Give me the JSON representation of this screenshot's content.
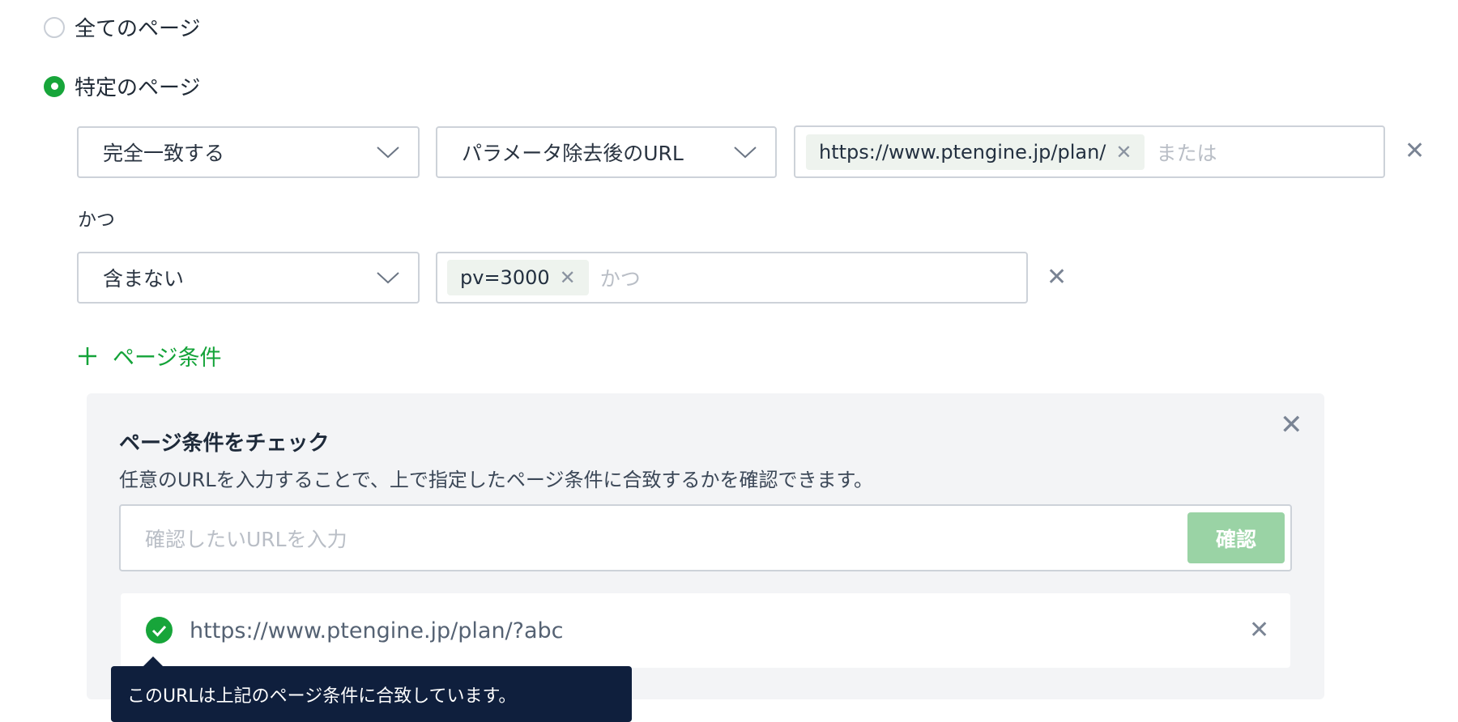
{
  "scope": {
    "options": [
      {
        "label": "全てのページ",
        "selected": false
      },
      {
        "label": "特定のページ",
        "selected": true
      }
    ]
  },
  "conditions": {
    "row1": {
      "match_type": "完全一致する",
      "target": "パラメータ除去後のURL",
      "chip": "https://www.ptengine.jp/plan/",
      "placeholder": "または"
    },
    "connector": "かつ",
    "row2": {
      "match_type": "含まない",
      "chip": "pv=3000",
      "placeholder": "かつ"
    },
    "add_label": "ページ条件"
  },
  "checker": {
    "title": "ページ条件をチェック",
    "description": "任意のURLを入力することで、上で指定したページ条件に合致するかを確認できます。",
    "input_placeholder": "確認したいURLを入力",
    "confirm_label": "確認",
    "result_url": "https://www.ptengine.jp/plan/?abc",
    "result_status": "match",
    "tooltip": "このURLは上記のページ条件に合致しています。"
  },
  "colors": {
    "accent": "#17a53a",
    "confirm_disabled": "#9ad3a5",
    "tooltip_bg": "#0f1f3d",
    "panel_bg": "#f3f4f6"
  },
  "icons": {
    "chevron": "chevron-down-icon",
    "close": "close-icon",
    "plus": "plus-icon",
    "check": "check-circle-icon"
  }
}
